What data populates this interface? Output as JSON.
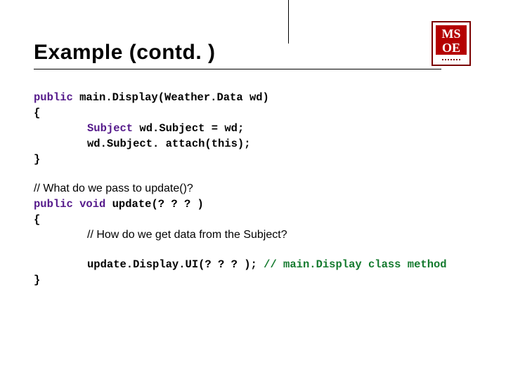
{
  "title": "Example (contd. )",
  "logo": {
    "line1": "MS",
    "line2": "OE"
  },
  "code": {
    "l1a": "public",
    "l1b": " main.Display(Weather.Data wd)",
    "l2": "{",
    "l3a": "Subject",
    "l3b": " wd.Subject = wd;",
    "l4": "wd.Subject. attach(this);",
    "l5": "}",
    "c1": "// What do we pass to update()?",
    "l6a": "public void",
    "l6b": " update(? ? ? )",
    "l7": "{",
    "c2": "// How do we get data from the Subject?",
    "l8a": "update.Display.UI(? ? ? ); ",
    "l8b": "// main.Display class method",
    "l9": "}"
  }
}
